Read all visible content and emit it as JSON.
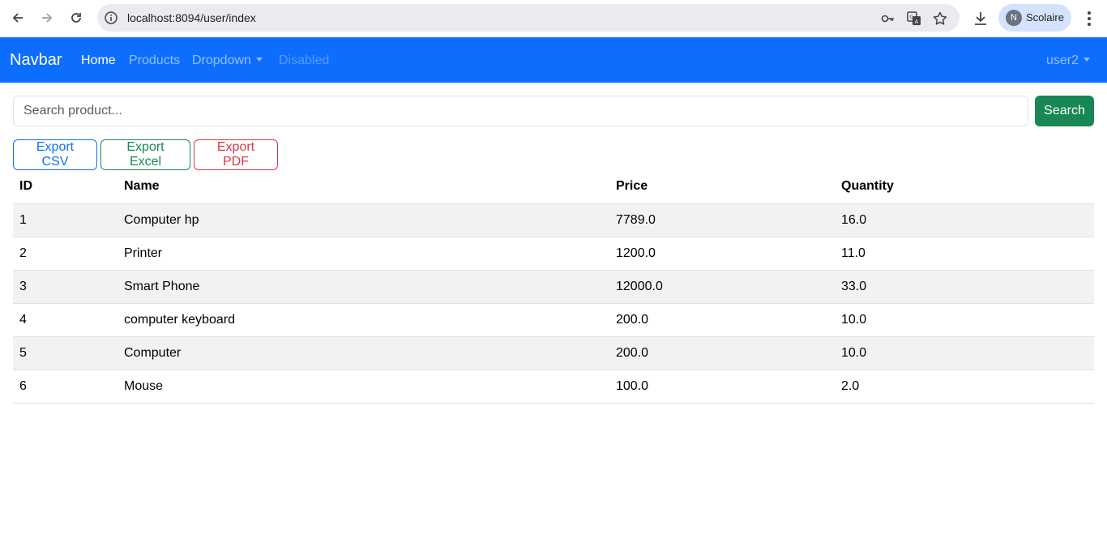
{
  "browser": {
    "url": "localhost:8094/user/index",
    "profile_initial": "N",
    "profile_name": "Scolaire"
  },
  "navbar": {
    "brand": "Navbar",
    "links": [
      {
        "label": "Home",
        "state": "active"
      },
      {
        "label": "Products",
        "state": "normal"
      },
      {
        "label": "Dropdown",
        "state": "dropdown"
      },
      {
        "label": "Disabled",
        "state": "disabled"
      }
    ],
    "user": "user2"
  },
  "search": {
    "placeholder": "Search product...",
    "value": "",
    "button_label": "Search"
  },
  "exports": {
    "csv_label": "Export CSV",
    "excel_label": "Export Excel",
    "pdf_label": "Export PDF"
  },
  "table": {
    "headers": [
      "ID",
      "Name",
      "Price",
      "Quantity"
    ],
    "rows": [
      [
        "1",
        "Computer hp",
        "7789.0",
        "16.0"
      ],
      [
        "2",
        "Printer",
        "1200.0",
        "11.0"
      ],
      [
        "3",
        "Smart Phone",
        "12000.0",
        "33.0"
      ],
      [
        "4",
        "computer keyboard",
        "200.0",
        "10.0"
      ],
      [
        "5",
        "Computer",
        "200.0",
        "10.0"
      ],
      [
        "6",
        "Mouse",
        "100.0",
        "2.0"
      ]
    ]
  },
  "colors": {
    "primary": "#0d6efd",
    "success": "#198754",
    "danger": "#dc3545"
  }
}
